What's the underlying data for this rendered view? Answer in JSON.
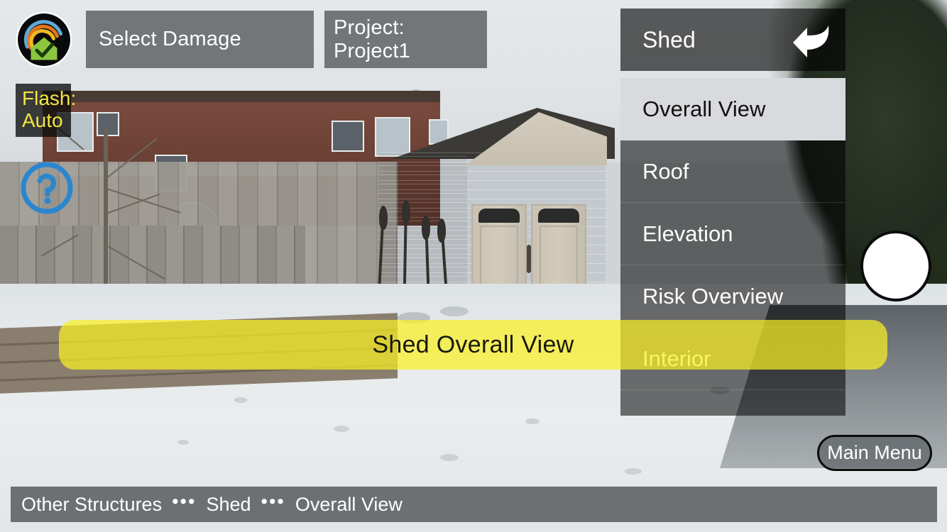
{
  "app": {
    "logo_icon": "house-check-logo-icon"
  },
  "toolbar": {
    "select_damage_label": "Select Damage",
    "project_label": "Project: Project1"
  },
  "camera": {
    "flash_label": "Flash:",
    "flash_value": "Auto",
    "flash_text_color": "#f2e640",
    "help_icon": "question-mark-circle-icon",
    "help_icon_color": "#2b86d0",
    "shutter_icon": "camera-shutter-icon"
  },
  "menu": {
    "title": "Shed",
    "back_icon": "back-arrow-icon",
    "items": [
      {
        "label": "Overall View",
        "selected": true
      },
      {
        "label": "Roof",
        "selected": false
      },
      {
        "label": "Elevation",
        "selected": false
      },
      {
        "label": "Risk Overview",
        "selected": false
      },
      {
        "label": "Interior",
        "selected": false
      }
    ]
  },
  "banner": {
    "label": "Shed Overall View",
    "color": "#faf023"
  },
  "main_menu": {
    "label": "Main Menu"
  },
  "breadcrumb": {
    "separator": "•••",
    "items": [
      {
        "label": "Other Structures"
      },
      {
        "label": "Shed"
      },
      {
        "label": "Overall View"
      }
    ]
  }
}
